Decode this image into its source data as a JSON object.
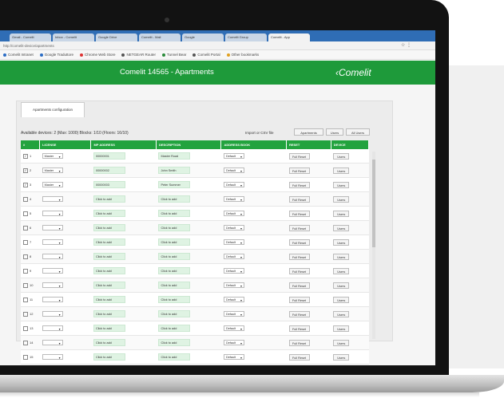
{
  "browser": {
    "tabs": [
      {
        "label": "Gmail - Comelit"
      },
      {
        "label": "Inbox - Comelit"
      },
      {
        "label": "Google Drive"
      },
      {
        "label": "Comelit - Mail"
      },
      {
        "label": "Google"
      },
      {
        "label": "Comelit Group"
      },
      {
        "label": "Comelit - App",
        "active": true
      }
    ],
    "url": "http://comelit-device/apartments",
    "bookmarks": [
      {
        "label": "Comelit Intranet",
        "color": "#2b6cc4"
      },
      {
        "label": "Google Traduttore",
        "color": "#2b6cc4"
      },
      {
        "label": "Chrome Web Store",
        "color": "#d33"
      },
      {
        "label": "NETGEAR Router",
        "color": "#555"
      },
      {
        "label": "Tunnel Bear",
        "color": "#2a8a3a"
      },
      {
        "label": "Comelit Portal",
        "color": "#555"
      },
      {
        "label": "Other bookmarks",
        "color": "#e0a020"
      }
    ]
  },
  "app": {
    "title": "Comelit 14565 - Apartments",
    "logo": "‹Comelit",
    "header_color": "#1e9a3a"
  },
  "page": {
    "tab_label": "Apartments configuration",
    "info": "Available devices: 2 (Max: 1000)  Blocks: 1/10 (Floors: 16/10)",
    "export_label": "Import or CSV file",
    "buttons": {
      "apartments": "Apartments",
      "users": "Users",
      "all_users": "All Users"
    }
  },
  "table": {
    "headers": [
      "#",
      "LICENSE",
      "MP ADDRESS",
      "DESCRIPTION",
      "ADDRESS BOOK",
      "RESET",
      "DEVICE"
    ],
    "rows": [
      {
        "checked": true,
        "num": "1",
        "license": "Master",
        "mp": "00000001",
        "desc": "Master Road",
        "book": "Default",
        "reset": "Full Reset",
        "device": "Users"
      },
      {
        "checked": true,
        "num": "2",
        "license": "Master",
        "mp": "00000002",
        "desc": "John Smith",
        "book": "Default",
        "reset": "Full Reset",
        "device": "Users"
      },
      {
        "checked": true,
        "num": "3",
        "license": "Master",
        "mp": "00000003",
        "desc": "Peter Summer",
        "book": "Default",
        "reset": "Full Reset",
        "device": "Users"
      },
      {
        "checked": false,
        "num": "4",
        "license": "",
        "mp": "Click to add",
        "desc": "Click to add",
        "book": "Default",
        "reset": "Full Reset",
        "device": "Users"
      },
      {
        "checked": false,
        "num": "5",
        "license": "",
        "mp": "Click to add",
        "desc": "Click to add",
        "book": "Default",
        "reset": "Full Reset",
        "device": "Users"
      },
      {
        "checked": false,
        "num": "6",
        "license": "",
        "mp": "Click to add",
        "desc": "Click to add",
        "book": "Default",
        "reset": "Full Reset",
        "device": "Users"
      },
      {
        "checked": false,
        "num": "7",
        "license": "",
        "mp": "Click to add",
        "desc": "Click to add",
        "book": "Default",
        "reset": "Full Reset",
        "device": "Users"
      },
      {
        "checked": false,
        "num": "8",
        "license": "",
        "mp": "Click to add",
        "desc": "Click to add",
        "book": "Default",
        "reset": "Full Reset",
        "device": "Users"
      },
      {
        "checked": false,
        "num": "9",
        "license": "",
        "mp": "Click to add",
        "desc": "Click to add",
        "book": "Default",
        "reset": "Full Reset",
        "device": "Users"
      },
      {
        "checked": false,
        "num": "10",
        "license": "",
        "mp": "Click to add",
        "desc": "Click to add",
        "book": "Default",
        "reset": "Full Reset",
        "device": "Users"
      },
      {
        "checked": false,
        "num": "11",
        "license": "",
        "mp": "Click to add",
        "desc": "Click to add",
        "book": "Default",
        "reset": "Full Reset",
        "device": "Users"
      },
      {
        "checked": false,
        "num": "12",
        "license": "",
        "mp": "Click to add",
        "desc": "Click to add",
        "book": "Default",
        "reset": "Full Reset",
        "device": "Users"
      },
      {
        "checked": false,
        "num": "13",
        "license": "",
        "mp": "Click to add",
        "desc": "Click to add",
        "book": "Default",
        "reset": "Full Reset",
        "device": "Users"
      },
      {
        "checked": false,
        "num": "14",
        "license": "",
        "mp": "Click to add",
        "desc": "Click to add",
        "book": "Default",
        "reset": "Full Reset",
        "device": "Users"
      },
      {
        "checked": false,
        "num": "15",
        "license": "",
        "mp": "Click to add",
        "desc": "Click to add",
        "book": "Default",
        "reset": "Full Reset",
        "device": "Users"
      }
    ]
  }
}
